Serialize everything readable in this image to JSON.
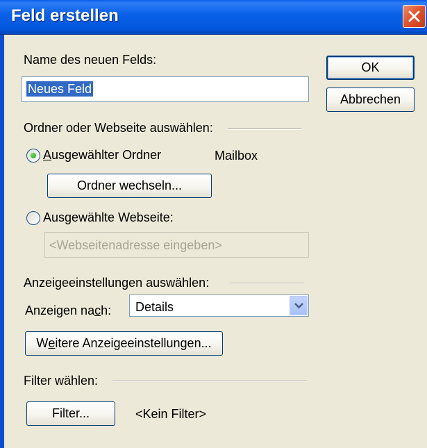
{
  "window": {
    "title": "Feld erstellen"
  },
  "name_section": {
    "label": "Name des neuen Felds:",
    "value": "Neues Feld"
  },
  "buttons": {
    "ok": "OK",
    "cancel": "Abbrechen"
  },
  "folder_section": {
    "heading": "Ordner oder Webseite auswählen:",
    "selected_folder": {
      "label_prefix": "",
      "label_accel": "A",
      "label_rest": "usgewählter Ordner",
      "value": "Mailbox",
      "checked": true
    },
    "change_folder_button": "Ordner wechseln...",
    "selected_webpage": {
      "label": "Ausgewählte Webseite:",
      "checked": false
    },
    "webpage_placeholder": "<Webseitenadresse eingeben>"
  },
  "display_section": {
    "heading": "Anzeigeeinstellungen auswählen:",
    "show_by_label_prefix": "Anzeigen na",
    "show_by_label_accel": "c",
    "show_by_label_rest": "h:",
    "show_by_value": "Details",
    "more_settings_prefix": "W",
    "more_settings_accel": "e",
    "more_settings_rest": "itere Anzeigeeinstellungen..."
  },
  "filter_section": {
    "heading": "Filter wählen:",
    "filter_button": "Filter...",
    "filter_value": "<Kein Filter>"
  },
  "icons": {
    "close": "close-icon",
    "dropdown": "chevron-down-icon"
  },
  "colors": {
    "titlebar": "#0a5ee6",
    "dialog_bg": "#ece9d8",
    "selection": "#316ac5",
    "close_button": "#e1552f"
  }
}
